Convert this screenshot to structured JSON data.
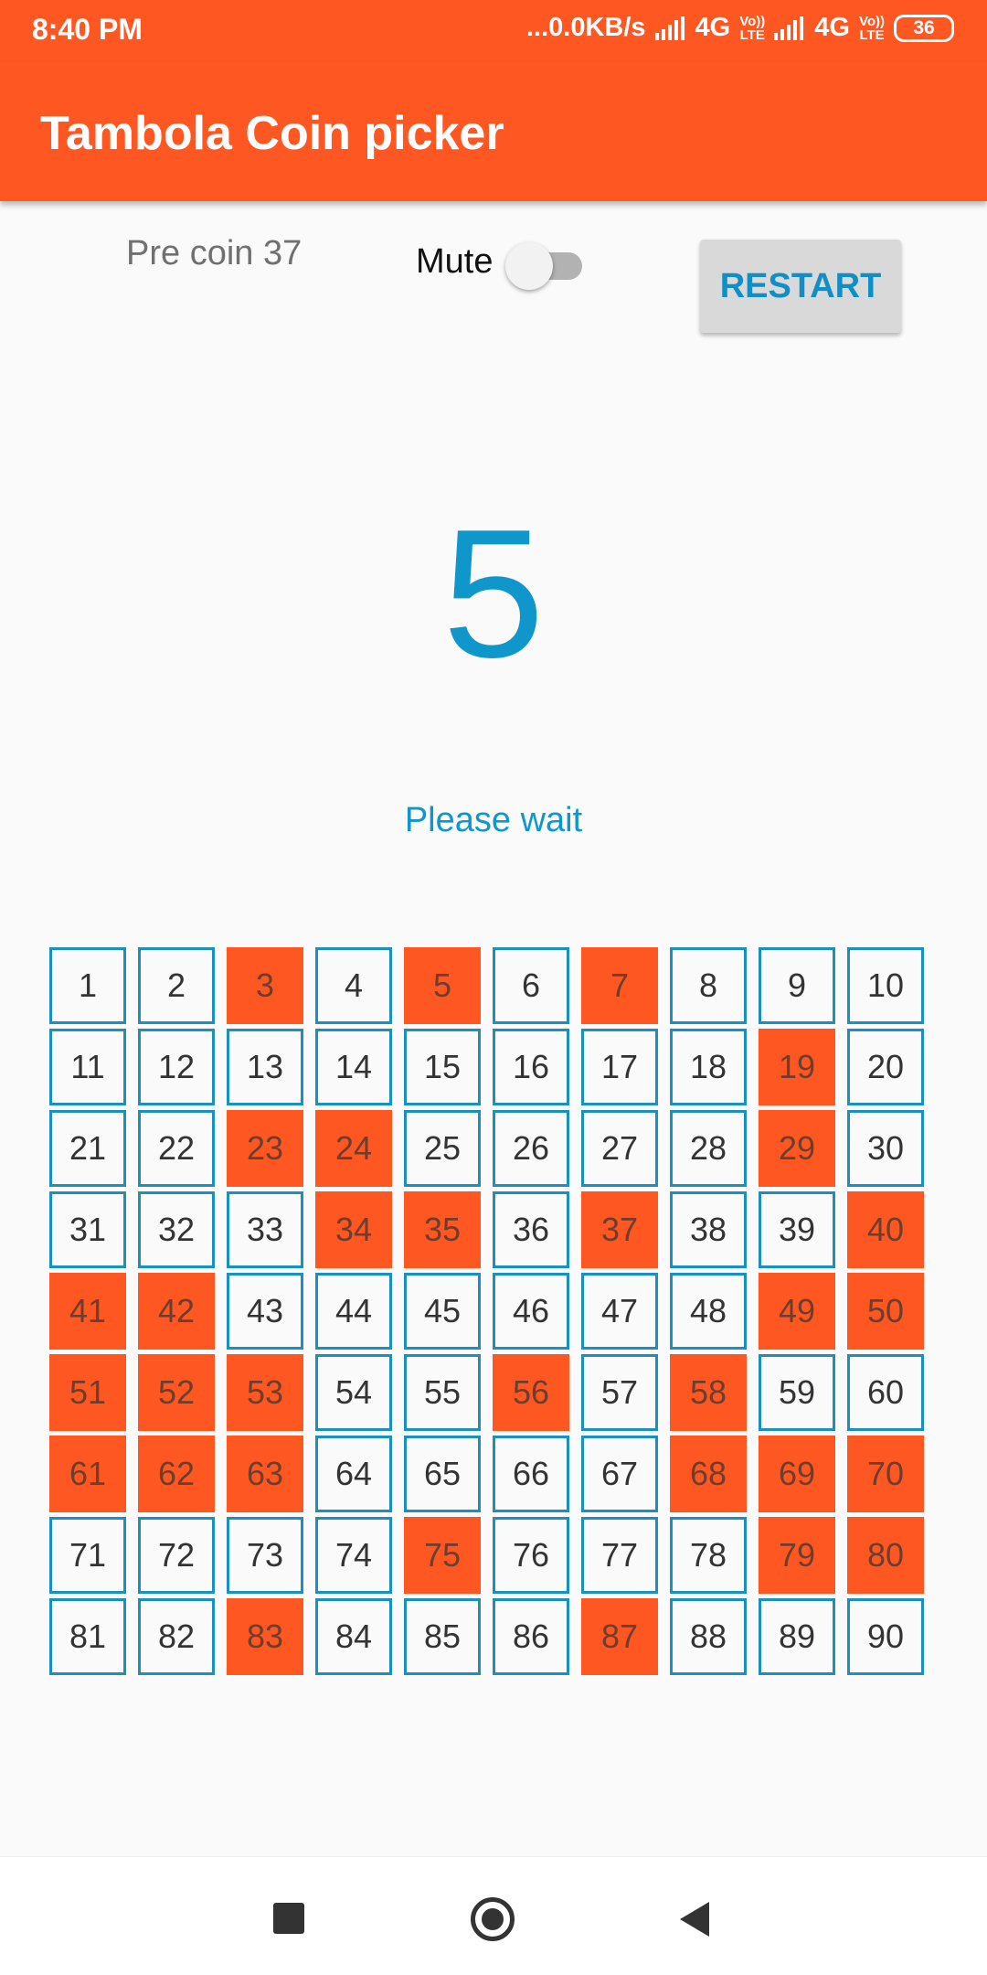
{
  "status_bar": {
    "time": "8:40 PM",
    "network_speed": "...0.0KB/s",
    "net_type_1": "4G",
    "volte_1": "Vo))\nLTE",
    "net_type_2": "4G",
    "volte_2": "Vo))\nLTE",
    "battery": "36"
  },
  "app_bar": {
    "title": "Tambola Coin picker",
    "color": "#ff5722"
  },
  "controls": {
    "pre_coin": "Pre coin 37",
    "mute_label": "Mute",
    "mute_on": false,
    "restart_label": "RESTART"
  },
  "current_coin": "5",
  "status_message": "Please wait",
  "board": {
    "picked_color": "#ff5722",
    "border_color": "#1b8fbf",
    "numbers": [
      "1",
      "2",
      "3",
      "4",
      "5",
      "6",
      "7",
      "8",
      "9",
      "10",
      "11",
      "12",
      "13",
      "14",
      "15",
      "16",
      "17",
      "18",
      "19",
      "20",
      "21",
      "22",
      "23",
      "24",
      "25",
      "26",
      "27",
      "28",
      "29",
      "30",
      "31",
      "32",
      "33",
      "34",
      "35",
      "36",
      "37",
      "38",
      "39",
      "40",
      "41",
      "42",
      "43",
      "44",
      "45",
      "46",
      "47",
      "48",
      "49",
      "50",
      "51",
      "52",
      "53",
      "54",
      "55",
      "56",
      "57",
      "58",
      "59",
      "60",
      "61",
      "62",
      "63",
      "64",
      "65",
      "66",
      "67",
      "68",
      "69",
      "70",
      "71",
      "72",
      "73",
      "74",
      "75",
      "76",
      "77",
      "78",
      "79",
      "80",
      "81",
      "82",
      "83",
      "84",
      "85",
      "86",
      "87",
      "88",
      "89",
      "90"
    ],
    "picked": [
      3,
      5,
      7,
      19,
      23,
      24,
      29,
      34,
      35,
      37,
      40,
      41,
      42,
      49,
      50,
      51,
      52,
      53,
      56,
      58,
      61,
      62,
      63,
      68,
      69,
      70,
      75,
      79,
      80,
      83,
      87
    ]
  },
  "nav_bar": {
    "icons": [
      "recents-square-icon",
      "home-circle-icon",
      "back-triangle-icon"
    ]
  }
}
